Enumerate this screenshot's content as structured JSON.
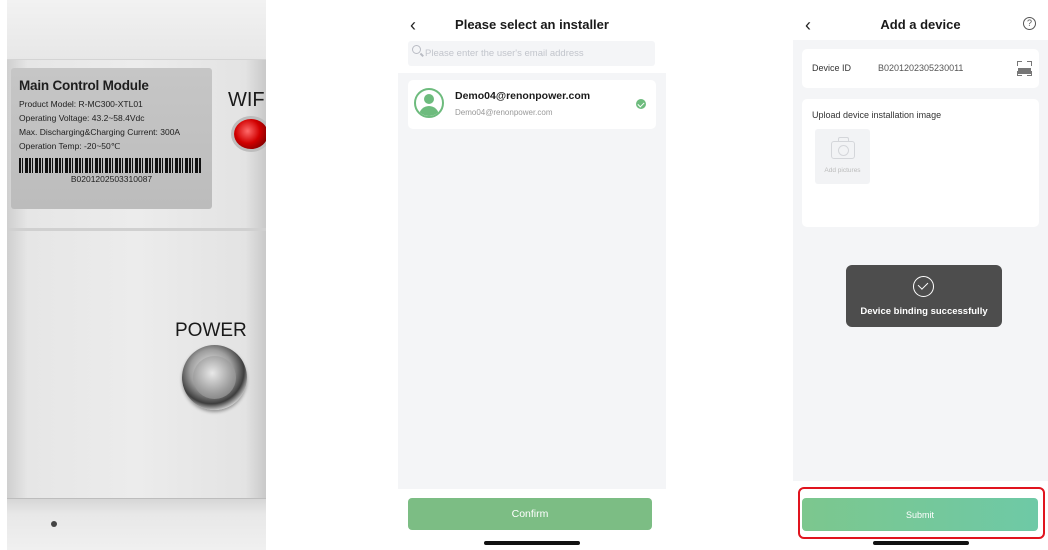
{
  "photo": {
    "label": {
      "title": "Main Control Module",
      "model": "Product Model: R-MC300-XTL01",
      "voltage": "Operating Voltage: 43.2~58.4Vdc",
      "current": "Max. Discharging&Charging Current: 300A",
      "temp": "Operation Temp: -20~50℃",
      "serial": "B0201202503310087"
    },
    "wifi": "WIFI",
    "power": "POWER"
  },
  "screen1": {
    "title": "Please select an installer",
    "back_icon": "chevron-left-icon",
    "search": {
      "placeholder": "Please enter the user's email address"
    },
    "users": [
      {
        "name": "Demo04@renonpower.com",
        "email": "Demo04@renonpower.com",
        "selected": true
      }
    ],
    "confirm_label": "Confirm",
    "accent": "#7cbd84"
  },
  "screen2": {
    "title": "Add a device",
    "back_icon": "chevron-left-icon",
    "help_icon": "question-circle-icon",
    "device_id_label": "Device ID",
    "device_id_value": "B0201202305230011",
    "upload_title": "Upload device installation image",
    "add_pictures": "Add pictures",
    "toast": "Device binding successfully",
    "submit_label": "Submit",
    "highlight_color": "#e0141e"
  }
}
